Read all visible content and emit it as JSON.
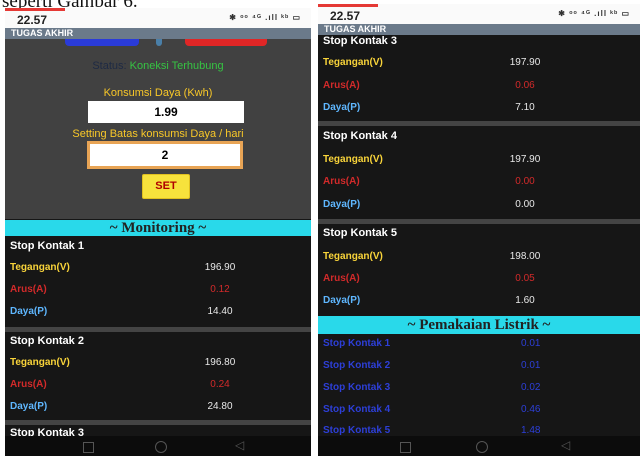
{
  "caption": "seperti Gambar 6.",
  "left": {
    "time": "22.57",
    "status_icons": "✱ ᵒᵒ ⁴ᴳ .ıll ᵏᵇ ▭",
    "app_title": "TUGAS AKHIR",
    "status_key": "Status:",
    "status_value": "Koneksi Terhubung",
    "konsumsi_label": "Konsumsi Daya (Kwh)",
    "konsumsi_value": "1.99",
    "setting_label": "Setting Batas konsumsi Daya / hari",
    "setting_value": "2",
    "set_button": "SET",
    "monitoring_title": "~ Monitoring ~",
    "kontak": [
      {
        "title": "Stop Kontak 1",
        "tegangan_label": "Tegangan(V)",
        "tegangan": "196.90",
        "arus_label": "Arus(A)",
        "arus": "0.12",
        "daya_label": "Daya(P)",
        "daya": "14.40"
      },
      {
        "title": "Stop Kontak 2",
        "tegangan_label": "Tegangan(V)",
        "tegangan": "196.80",
        "arus_label": "Arus(A)",
        "arus": "0.24",
        "daya_label": "Daya(P)",
        "daya": "24.80"
      },
      {
        "title": "Stop Kontak 3"
      }
    ]
  },
  "right": {
    "time": "22.57",
    "status_icons": "✱ ᵒᵒ ⁴ᴳ .ıll ᵏᵇ ▭",
    "app_title": "TUGAS AKHIR",
    "kontak": [
      {
        "title": "Stop Kontak 3",
        "tegangan_label": "Tegangan(V)",
        "tegangan": "197.90",
        "arus_label": "Arus(A)",
        "arus": "0.06",
        "daya_label": "Daya(P)",
        "daya": "7.10"
      },
      {
        "title": "Stop Kontak 4",
        "tegangan_label": "Tegangan(V)",
        "tegangan": "197.90",
        "arus_label": "Arus(A)",
        "arus": "0.00",
        "daya_label": "Daya(P)",
        "daya": "0.00"
      },
      {
        "title": "Stop Kontak 5",
        "tegangan_label": "Tegangan(V)",
        "tegangan": "198.00",
        "arus_label": "Arus(A)",
        "arus": "0.05",
        "daya_label": "Daya(P)",
        "daya": "1.60"
      }
    ],
    "pemakaian_title": "~ Pemakaian Listrik ~",
    "pemakaian": [
      {
        "label": "Stop Kontak 1",
        "value": "0.01"
      },
      {
        "label": "Stop Kontak 2",
        "value": "0.01"
      },
      {
        "label": "Stop Kontak 3",
        "value": "0.02"
      },
      {
        "label": "Stop Kontak 4",
        "value": "0.46"
      },
      {
        "label": "Stop Kontak 5",
        "value": "1.48"
      }
    ]
  },
  "colors": {
    "accent_cyan": "#29d9ea",
    "voltage_yellow": "#f9d43a",
    "current_red": "#d22a2a",
    "power_blue": "#5fb7ff",
    "connected_green": "#36c443",
    "set_button_yellow": "#f7e23c"
  }
}
